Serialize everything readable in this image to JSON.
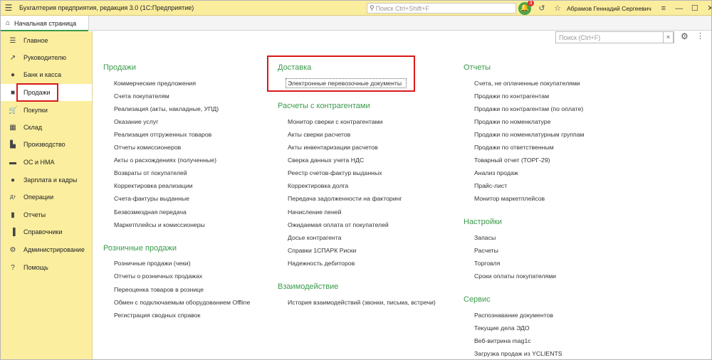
{
  "titlebar": {
    "menu_icon": "hamburger-icon",
    "title": "Бухгалтерия предприятия, редакция 3.0  (1С:Предприятие)",
    "search_placeholder": "Поиск Ctrl+Shift+F",
    "notifications_count": "3",
    "user": "Абрамов Геннадий Сергеевич"
  },
  "tabs": {
    "home": "Начальная страница"
  },
  "sidebar": {
    "items": [
      {
        "label": "Главное",
        "icon": "hamburger-icon"
      },
      {
        "label": "Руководителю",
        "icon": "trend-icon"
      },
      {
        "label": "Банк и касса",
        "icon": "coin-icon"
      },
      {
        "label": "Продажи",
        "icon": "bag-icon"
      },
      {
        "label": "Покупки",
        "icon": "cart-icon"
      },
      {
        "label": "Склад",
        "icon": "warehouse-icon"
      },
      {
        "label": "Производство",
        "icon": "factory-icon"
      },
      {
        "label": "ОС и НМА",
        "icon": "truck-icon"
      },
      {
        "label": "Зарплата и кадры",
        "icon": "people-icon"
      },
      {
        "label": "Операции",
        "icon": "operations-icon"
      },
      {
        "label": "Отчеты",
        "icon": "bar-chart-icon"
      },
      {
        "label": "Справочники",
        "icon": "book-icon"
      },
      {
        "label": "Администрирование",
        "icon": "gear-icon"
      },
      {
        "label": "Помощь",
        "icon": "help-icon"
      }
    ]
  },
  "main": {
    "search_placeholder": "Поиск (Ctrl+F)",
    "col1": {
      "sales_title": "Продажи",
      "sales": [
        "Коммерческие предложения",
        "Счета покупателям",
        "Реализация (акты, накладные, УПД)",
        "Оказание услуг",
        "Реализация отгруженных товаров",
        "Отчеты комиссионеров",
        "Акты о расхождениях (полученные)",
        "Возвраты от покупателей",
        "Корректировка реализации",
        "Счета-фактуры выданные",
        "Безвозмездная передача",
        "Маркетплейсы и комиссионеры"
      ],
      "retail_title": "Розничные продажи",
      "retail": [
        "Розничные продажи (чеки)",
        "Отчеты о розничных продажах",
        "Переоценка товаров в рознице",
        "Обмен с подключаемым оборудованием Offline",
        "Регистрация сводных справок"
      ]
    },
    "col2": {
      "delivery_title": "Доставка",
      "delivery": [
        "Электронные перевозочные документы"
      ],
      "settlements_title": "Расчеты с контрагентами",
      "settlements": [
        "Монитор сверки с контрагентами",
        "Акты сверки расчетов",
        "Акты инвентаризации расчетов",
        "Сверка данных учета НДС",
        "Реестр счетов-фактур выданных",
        "Корректировка долга",
        "Передача задолженности на факторинг",
        "Начисление пеней",
        "Ожидаемая оплата от покупателей",
        "Досье контрагента",
        "Справки 1СПАРК Риски",
        "Надежность дебиторов"
      ],
      "interaction_title": "Взаимодействие",
      "interaction": [
        "История взаимодействий (звонки, письма, встречи)"
      ]
    },
    "col3": {
      "reports_title": "Отчеты",
      "reports": [
        "Счета, не оплаченные покупателями",
        "Продажи по контрагентам",
        "Продажи по контрагентам (по оплате)",
        "Продажи по номенклатуре",
        "Продажи по номенклатурным группам",
        "Продажи по ответственным",
        "Товарный отчет (ТОРГ-29)",
        "Анализ продаж",
        "Прайс-лист",
        "Монитор маркетплейсов"
      ],
      "settings_title": "Настройки",
      "settings": [
        "Запасы",
        "Расчеты",
        "Торговля",
        "Сроки оплаты покупателями"
      ],
      "service_title": "Сервис",
      "service": [
        "Распознавание документов",
        "Текущие дела ЭДО",
        "Веб-витрина mag1c",
        "Загрузка продаж из YCLIENTS"
      ]
    }
  }
}
